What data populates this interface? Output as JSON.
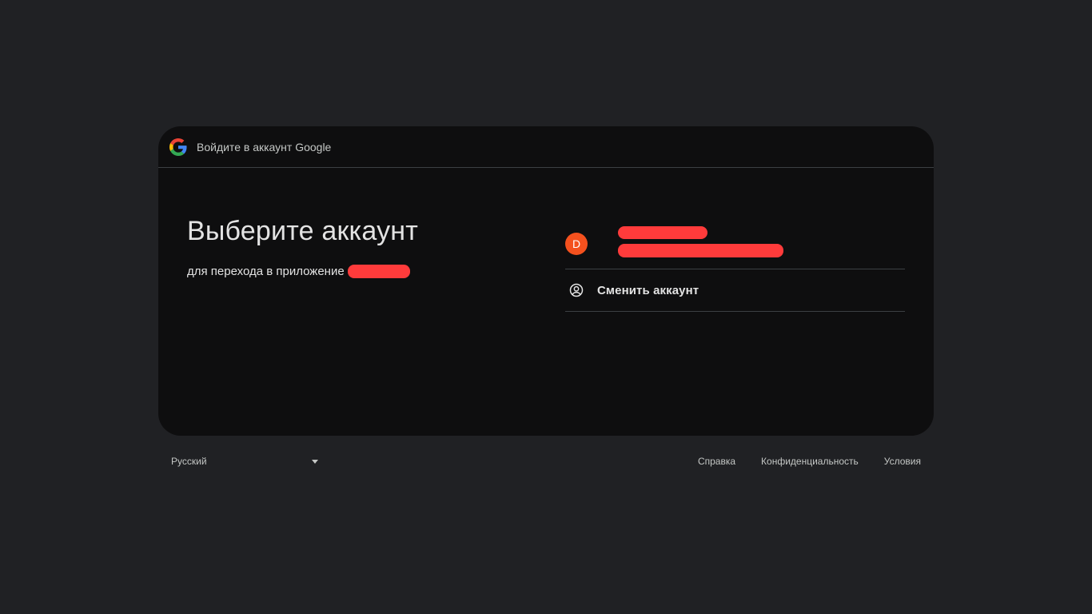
{
  "header": {
    "title": "Войдите в аккаунт Google",
    "logo_icon": "google-g-logo"
  },
  "main": {
    "title": "Выберите аккаунт",
    "subtitle_prefix": "для перехода в приложение",
    "app_name_redacted": true
  },
  "accounts": [
    {
      "avatar_letter": "D",
      "avatar_color": "#f4511e",
      "name_redacted": true,
      "email_redacted": true
    }
  ],
  "switch_account": {
    "label": "Сменить аккаунт",
    "icon": "account-circle-icon"
  },
  "footer": {
    "language": "Русский",
    "links": [
      "Справка",
      "Конфиденциальность",
      "Условия"
    ]
  },
  "colors": {
    "background": "#202124",
    "card": "#0e0e0f",
    "redaction": "#ff3b3b",
    "avatar": "#f4511e"
  }
}
